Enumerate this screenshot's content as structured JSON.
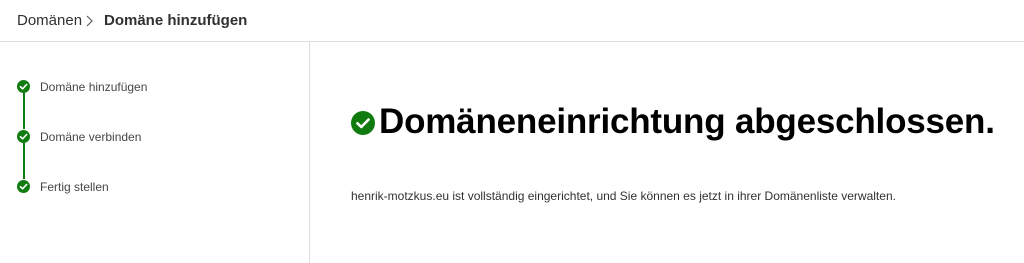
{
  "breadcrumb": {
    "root": "Domänen",
    "current": "Domäne hinzufügen"
  },
  "steps": [
    {
      "label": "Domäne hinzufügen",
      "status": "completed"
    },
    {
      "label": "Domäne verbinden",
      "status": "completed"
    },
    {
      "label": "Fertig stellen",
      "status": "completed"
    }
  ],
  "main": {
    "title": "Domäneneinrichtung abgeschlossen.",
    "description": "henrik-motzkus.eu ist vollständig eingerichtet, und Sie können es jetzt in ihrer Domänenliste verwalten.",
    "icon": "check-circle-icon"
  },
  "colors": {
    "success": "#107c10",
    "border": "#e1dfdd",
    "text": "#323130"
  }
}
